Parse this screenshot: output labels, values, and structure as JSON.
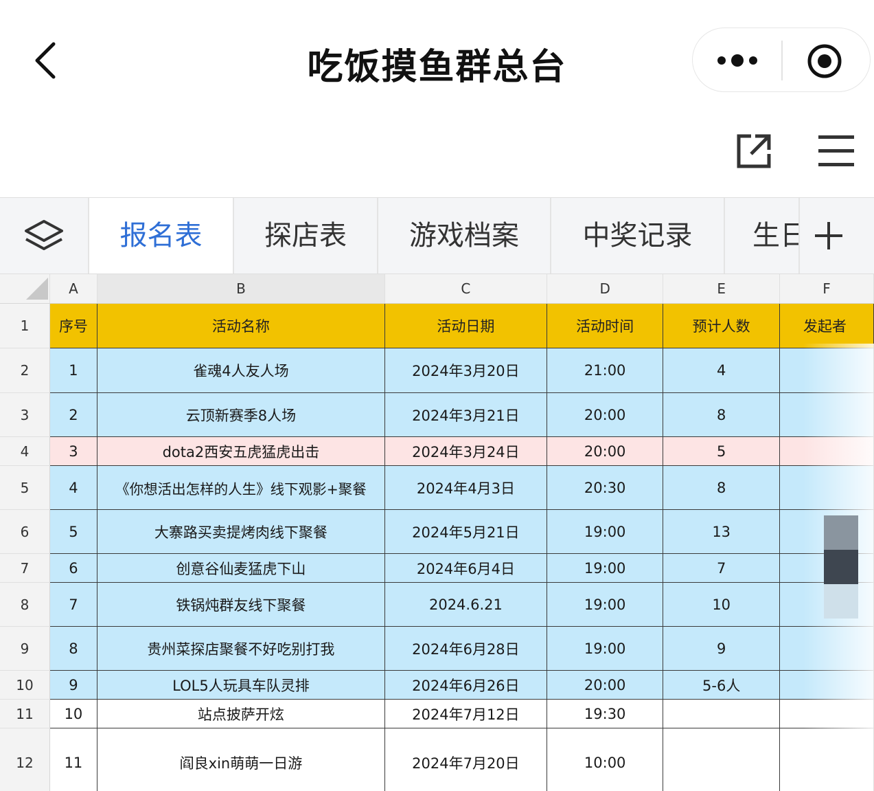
{
  "nav": {
    "title": "吃饭摸鱼群总台"
  },
  "tabs": [
    "报名表",
    "探店表",
    "游戏档案",
    "中奖记录",
    "生日"
  ],
  "columns": [
    "A",
    "B",
    "C",
    "D",
    "E",
    "F"
  ],
  "header_row": {
    "row": "1",
    "cells": [
      "序号",
      "活动名称",
      "活动日期",
      "活动时间",
      "预计人数",
      "发起者"
    ]
  },
  "rows": [
    {
      "row": "2",
      "cells": [
        "1",
        "雀魂4人友人场",
        "2024年3月20日",
        "21:00",
        "4",
        ""
      ]
    },
    {
      "row": "3",
      "cells": [
        "2",
        "云顶新赛季8人场",
        "2024年3月21日",
        "20:00",
        "8",
        ""
      ]
    },
    {
      "row": "4",
      "cells": [
        "3",
        "dota2西安五虎猛虎出击",
        "2024年3月24日",
        "20:00",
        "5",
        ""
      ]
    },
    {
      "row": "5",
      "cells": [
        "4",
        "《你想活出怎样的人生》线下观影+聚餐",
        "2024年4月3日",
        "20:30",
        "8",
        ""
      ]
    },
    {
      "row": "6",
      "cells": [
        "5",
        "大寨路买卖提烤肉线下聚餐",
        "2024年5月21日",
        "19:00",
        "13",
        ""
      ]
    },
    {
      "row": "7",
      "cells": [
        "6",
        "创意谷仙麦猛虎下山",
        "2024年6月4日",
        "19:00",
        "7",
        ""
      ]
    },
    {
      "row": "8",
      "cells": [
        "7",
        "铁锅炖群友线下聚餐",
        "2024.6.21",
        "19:00",
        "10",
        ""
      ]
    },
    {
      "row": "9",
      "cells": [
        "8",
        "贵州菜探店聚餐不好吃别打我",
        "2024年6月28日",
        "19:00",
        "9",
        ""
      ]
    },
    {
      "row": "10",
      "cells": [
        "9",
        "LOL5人玩具车队灵排",
        "2024年6月26日",
        "20:00",
        "5-6人",
        ""
      ]
    },
    {
      "row": "11",
      "cells": [
        "10",
        "站点披萨开炫",
        "2024年7月12日",
        "19:30",
        "",
        ""
      ]
    },
    {
      "row": "12",
      "cells": [
        "11",
        "阎良xin萌萌一日游",
        "2024年7月20日",
        "10:00",
        "",
        ""
      ]
    }
  ],
  "colors": {
    "header_fill": "#f2c200",
    "blue_fill": "#c5e9fb",
    "pink_fill": "#fde4e4",
    "active_tab": "#2f6fd6"
  },
  "icons": [
    "back-icon",
    "more-icon",
    "target-icon",
    "share-icon",
    "menu-icon",
    "layers-icon",
    "add-icon"
  ]
}
